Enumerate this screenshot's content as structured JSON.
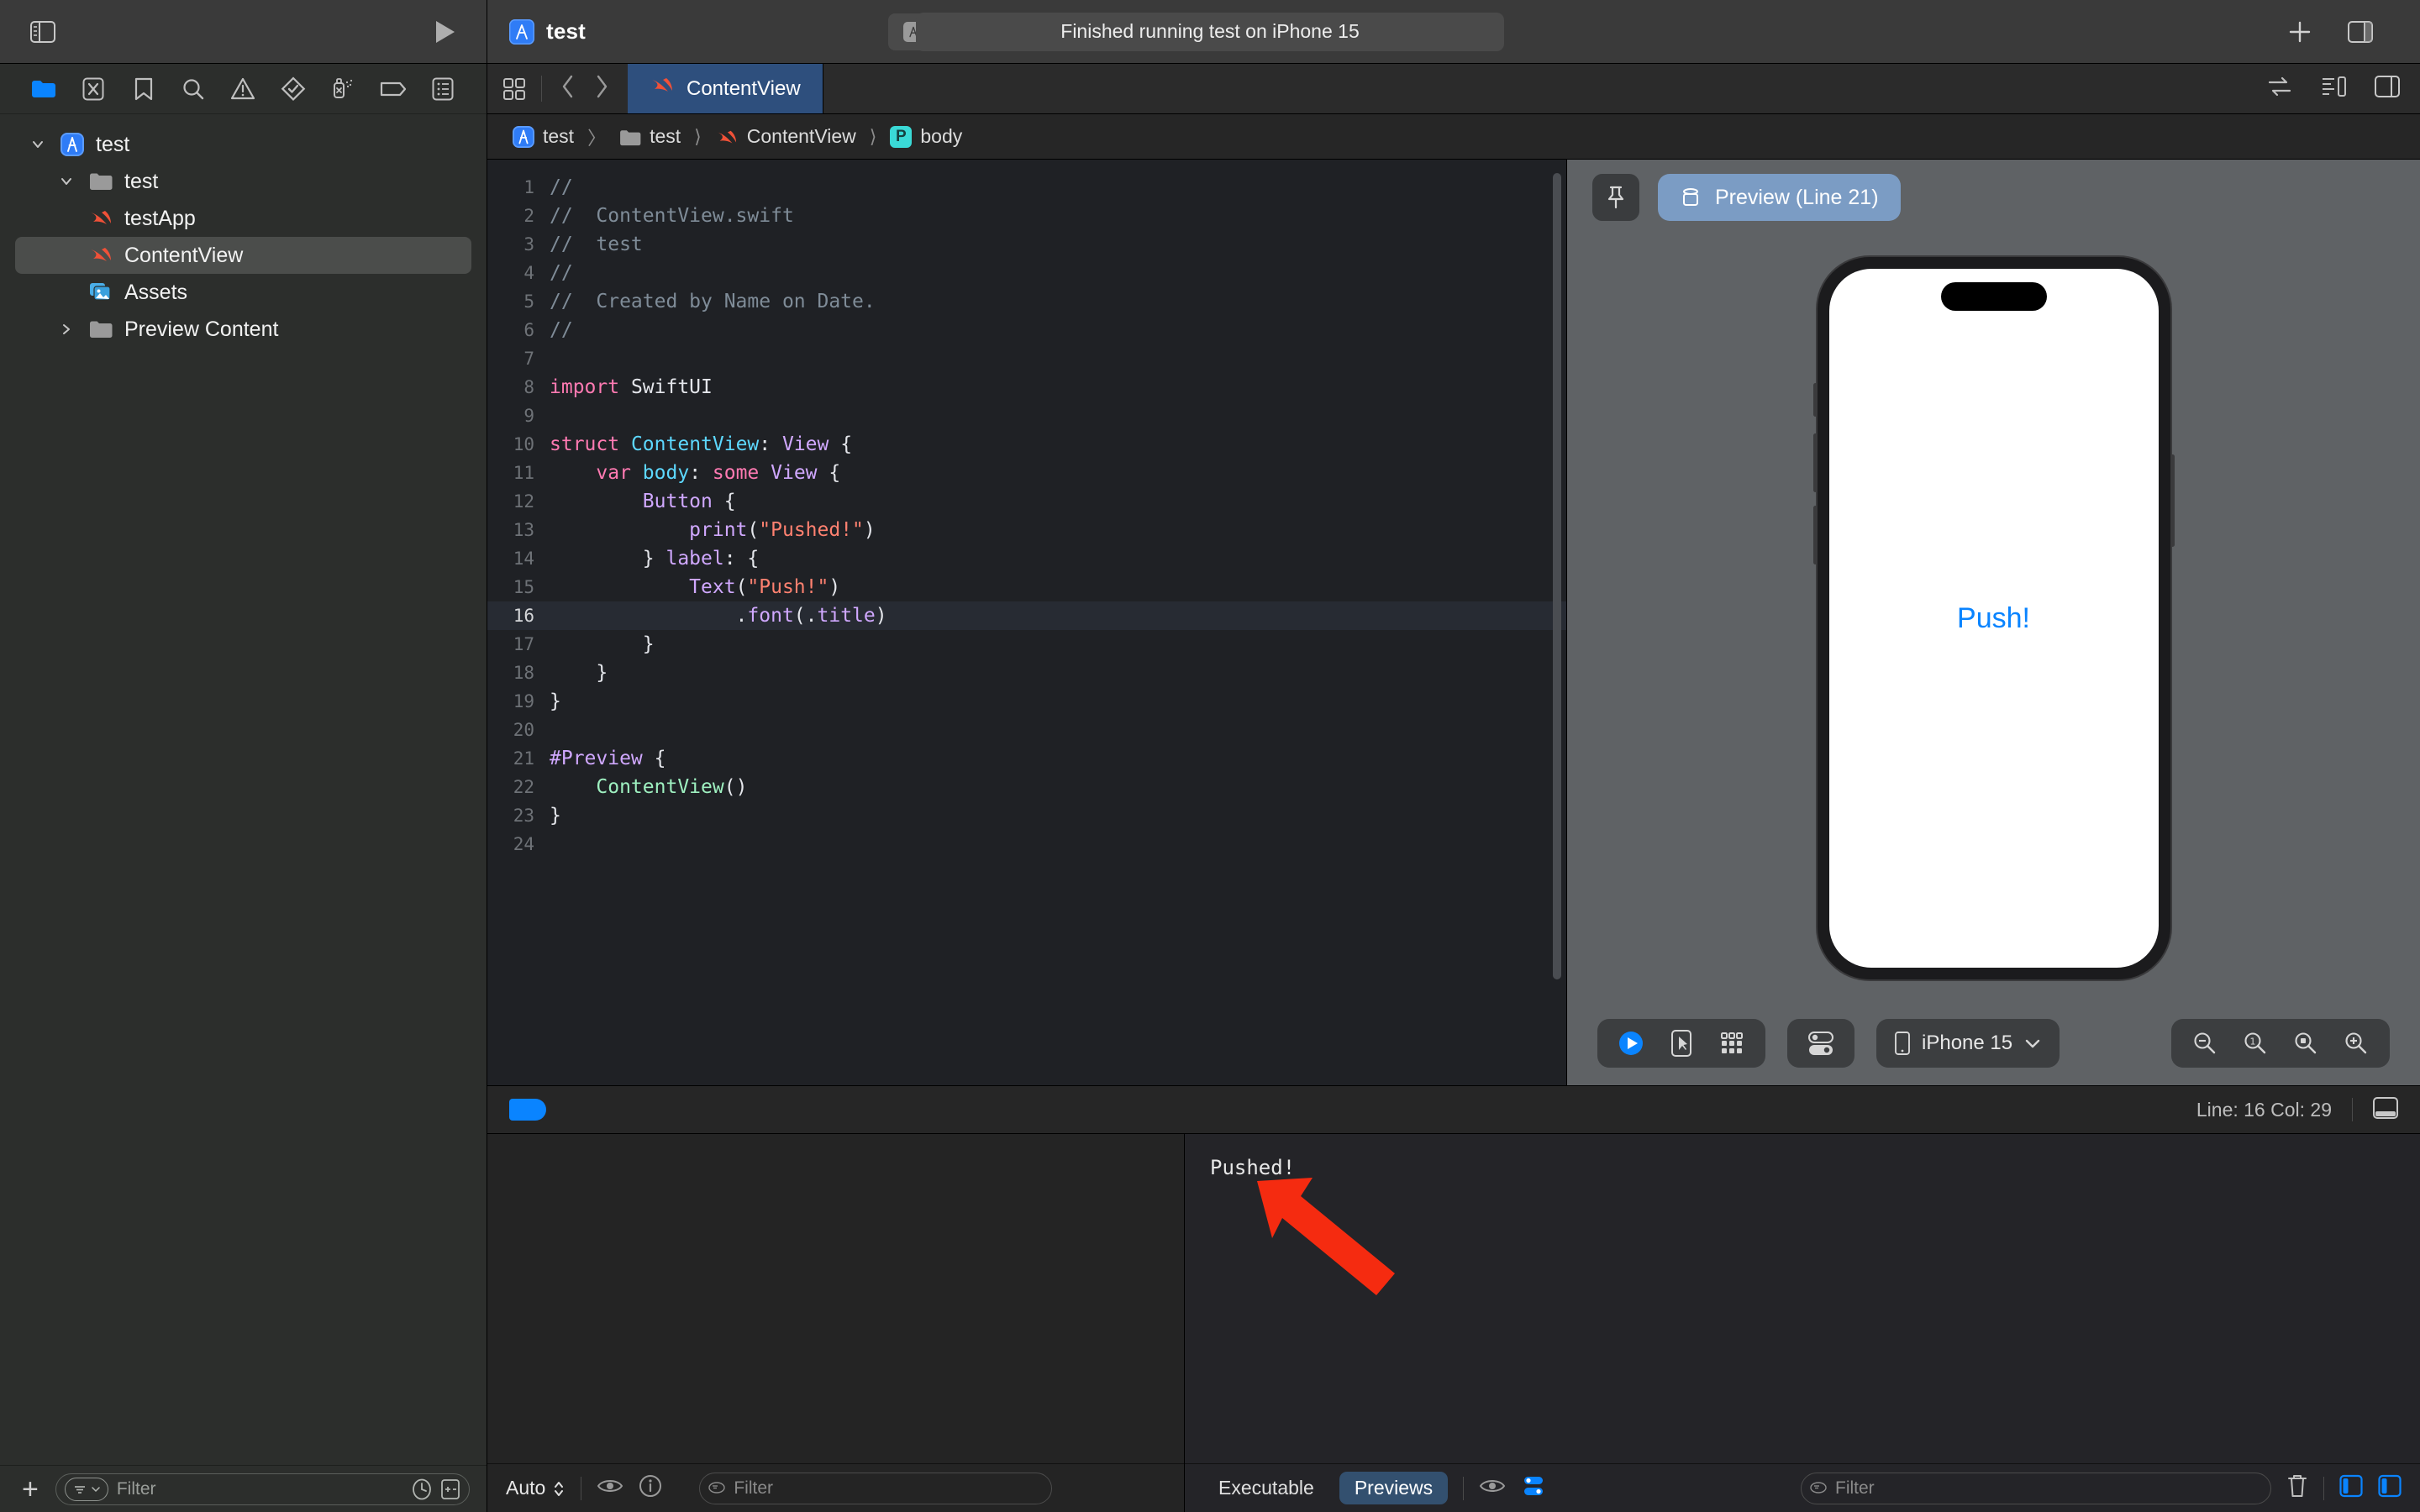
{
  "toolbar": {
    "project_name": "test",
    "scheme_name": "test",
    "destination": "iPhone 15",
    "status": "Finished running test on iPhone 15",
    "run_button": "run-button",
    "add_button": "+",
    "sidebar_toggle": "sidebar-toggle",
    "inspector_toggle": "inspector-toggle"
  },
  "navigator": {
    "tabs": [
      {
        "name": "project-navigator",
        "active": true
      },
      {
        "name": "source-control-navigator",
        "active": false
      },
      {
        "name": "bookmark-navigator",
        "active": false
      },
      {
        "name": "find-navigator",
        "active": false
      },
      {
        "name": "issue-navigator",
        "active": false
      },
      {
        "name": "test-navigator",
        "active": false
      },
      {
        "name": "debug-navigator",
        "active": false
      },
      {
        "name": "breakpoint-navigator",
        "active": false
      },
      {
        "name": "report-navigator",
        "active": false
      }
    ],
    "tree": [
      {
        "label": "test",
        "icon": "xcode-project-icon",
        "depth": 0,
        "twisty": "open",
        "selected": false
      },
      {
        "label": "test",
        "icon": "folder-icon",
        "depth": 1,
        "twisty": "open",
        "selected": false
      },
      {
        "label": "testApp",
        "icon": "swift-file-icon",
        "depth": 2,
        "twisty": "none",
        "selected": false
      },
      {
        "label": "ContentView",
        "icon": "swift-file-icon",
        "depth": 2,
        "twisty": "none",
        "selected": true
      },
      {
        "label": "Assets",
        "icon": "assets-icon",
        "depth": 2,
        "twisty": "none",
        "selected": false
      },
      {
        "label": "Preview Content",
        "icon": "folder-icon",
        "depth": 2,
        "twisty": "closed",
        "selected": false
      }
    ],
    "filter_placeholder": "Filter",
    "add_label": "+"
  },
  "editor": {
    "tab_label": "ContentView",
    "breadcrumb": [
      {
        "label": "test",
        "icon": "xcode-project-icon"
      },
      {
        "label": "test",
        "icon": "folder-icon"
      },
      {
        "label": "ContentView",
        "icon": "swift-file-icon"
      },
      {
        "label": "body",
        "icon": "property-badge"
      }
    ],
    "breadcrumb_separator": "〉",
    "highlighted_line": 16,
    "lines": [
      {
        "n": 1,
        "tokens": [
          {
            "t": "//",
            "c": "cmt"
          }
        ]
      },
      {
        "n": 2,
        "tokens": [
          {
            "t": "//  ContentView.swift",
            "c": "cmt"
          }
        ]
      },
      {
        "n": 3,
        "tokens": [
          {
            "t": "//  test",
            "c": "cmt"
          }
        ]
      },
      {
        "n": 4,
        "tokens": [
          {
            "t": "//",
            "c": "cmt"
          }
        ]
      },
      {
        "n": 5,
        "tokens": [
          {
            "t": "//  Created by Name on Date.",
            "c": "cmt"
          }
        ]
      },
      {
        "n": 6,
        "tokens": [
          {
            "t": "//",
            "c": "cmt"
          }
        ]
      },
      {
        "n": 7,
        "tokens": []
      },
      {
        "n": 8,
        "tokens": [
          {
            "t": "import",
            "c": "kw"
          },
          {
            "t": " SwiftUI",
            "c": "plain"
          }
        ]
      },
      {
        "n": 9,
        "tokens": []
      },
      {
        "n": 10,
        "tokens": [
          {
            "t": "struct",
            "c": "kw"
          },
          {
            "t": " ",
            "c": "plain"
          },
          {
            "t": "ContentView",
            "c": "typ"
          },
          {
            "t": ": ",
            "c": "plain"
          },
          {
            "t": "View",
            "c": "ptyp"
          },
          {
            "t": " {",
            "c": "plain"
          }
        ]
      },
      {
        "n": 11,
        "tokens": [
          {
            "t": "    ",
            "c": "plain"
          },
          {
            "t": "var",
            "c": "kw"
          },
          {
            "t": " ",
            "c": "plain"
          },
          {
            "t": "body",
            "c": "typ"
          },
          {
            "t": ": ",
            "c": "plain"
          },
          {
            "t": "some",
            "c": "kw"
          },
          {
            "t": " ",
            "c": "plain"
          },
          {
            "t": "View",
            "c": "ptyp"
          },
          {
            "t": " {",
            "c": "plain"
          }
        ]
      },
      {
        "n": 12,
        "tokens": [
          {
            "t": "        ",
            "c": "plain"
          },
          {
            "t": "Button",
            "c": "ptyp"
          },
          {
            "t": " {",
            "c": "plain"
          }
        ]
      },
      {
        "n": 13,
        "tokens": [
          {
            "t": "            ",
            "c": "plain"
          },
          {
            "t": "print",
            "c": "fn"
          },
          {
            "t": "(",
            "c": "plain"
          },
          {
            "t": "\"Pushed!\"",
            "c": "str"
          },
          {
            "t": ")",
            "c": "plain"
          }
        ]
      },
      {
        "n": 14,
        "tokens": [
          {
            "t": "        } ",
            "c": "plain"
          },
          {
            "t": "label",
            "c": "fn"
          },
          {
            "t": ": {",
            "c": "plain"
          }
        ]
      },
      {
        "n": 15,
        "tokens": [
          {
            "t": "            ",
            "c": "plain"
          },
          {
            "t": "Text",
            "c": "ptyp"
          },
          {
            "t": "(",
            "c": "plain"
          },
          {
            "t": "\"Push!\"",
            "c": "str"
          },
          {
            "t": ")",
            "c": "plain"
          }
        ]
      },
      {
        "n": 16,
        "tokens": [
          {
            "t": "                .",
            "c": "plain"
          },
          {
            "t": "font",
            "c": "fn"
          },
          {
            "t": "(",
            "c": "plain"
          },
          {
            "t": ".",
            "c": "plain"
          },
          {
            "t": "title",
            "c": "fn"
          },
          {
            "t": ")",
            "c": "plain"
          }
        ]
      },
      {
        "n": 17,
        "tokens": [
          {
            "t": "        }",
            "c": "plain"
          }
        ]
      },
      {
        "n": 18,
        "tokens": [
          {
            "t": "    }",
            "c": "plain"
          }
        ]
      },
      {
        "n": 19,
        "tokens": [
          {
            "t": "}",
            "c": "plain"
          }
        ]
      },
      {
        "n": 20,
        "tokens": []
      },
      {
        "n": 21,
        "tokens": [
          {
            "t": "#Preview",
            "c": "ptyp"
          },
          {
            "t": " {",
            "c": "plain"
          }
        ]
      },
      {
        "n": 22,
        "tokens": [
          {
            "t": "    ",
            "c": "plain"
          },
          {
            "t": "ContentView",
            "c": "gtyp"
          },
          {
            "t": "()",
            "c": "plain"
          }
        ]
      },
      {
        "n": 23,
        "tokens": [
          {
            "t": "}",
            "c": "plain"
          }
        ]
      },
      {
        "n": 24,
        "tokens": []
      }
    ]
  },
  "preview": {
    "chip_label": "Preview (Line 21)",
    "pin_icon": "pin-icon",
    "device_label": "iPhone 15",
    "canvas_text": "Push!",
    "canvas_text_color": "#0a84ff",
    "controls": [
      "live-preview-button",
      "selectable-button",
      "variants-button",
      "device-settings-button"
    ],
    "zoom_controls": [
      "zoom-out-button",
      "zoom-actual-button",
      "zoom-fit-button",
      "zoom-in-button"
    ]
  },
  "status_bar": {
    "line_col": "Line: 16  Col: 29",
    "debug_area_toggle": "debug-area-toggle"
  },
  "debug": {
    "variables": {
      "auto_label": "Auto",
      "filter_placeholder": "Filter"
    },
    "console": {
      "output": "Pushed!",
      "filter_placeholder": "Filter"
    },
    "segments": [
      {
        "label": "Executable",
        "active": false
      },
      {
        "label": "Previews",
        "active": true
      }
    ]
  },
  "colors": {
    "accent_blue": "#0a84ff",
    "tab_blue": "#2e4f7d",
    "preview_chip_blue": "#7b9cc4",
    "swift_orange": "#f05138",
    "annotation_red": "#f52b10"
  }
}
